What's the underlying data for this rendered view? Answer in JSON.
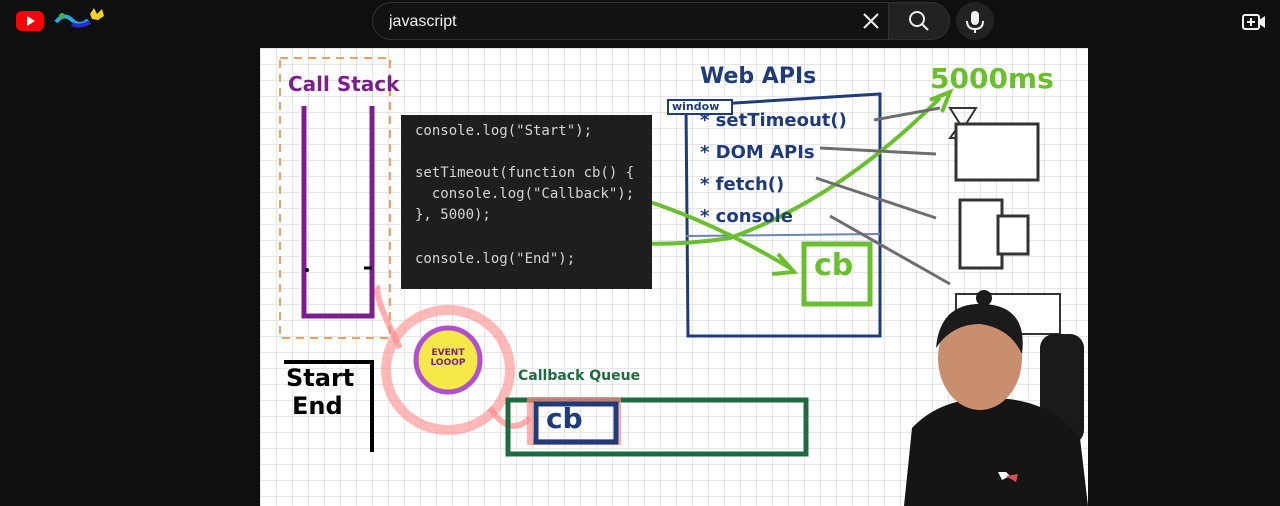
{
  "header": {
    "search": {
      "value": "javascript"
    }
  },
  "video": {
    "labels": {
      "call_stack": "Call Stack",
      "web_apis": "Web APIs",
      "window": "window",
      "timer": "5000ms",
      "callback_queue": "Callback Queue",
      "event_loop": "EVENT LOOOP",
      "output_start": "Start",
      "output_end": "End",
      "cb_web": "cb",
      "cb_queue": "cb"
    },
    "web_apis_list": [
      "* setTimeout()",
      "* DOM APIs",
      "* fetch()",
      "* console"
    ],
    "code_lines": [
      "console.log(\"Start\");",
      "",
      "setTimeout(function cb() {",
      "  console.log(\"Callback\");",
      "}, 5000);",
      "",
      "console.log(\"End\");"
    ],
    "colors": {
      "purple": "#7b1f8c",
      "navy": "#1f3b7a",
      "green": "#6abf2e",
      "queue_green": "#1d6b3f",
      "orange_dash": "#f0a060",
      "loop_yellow": "#f7e84a",
      "glow_red": "#ff8a8a"
    }
  }
}
